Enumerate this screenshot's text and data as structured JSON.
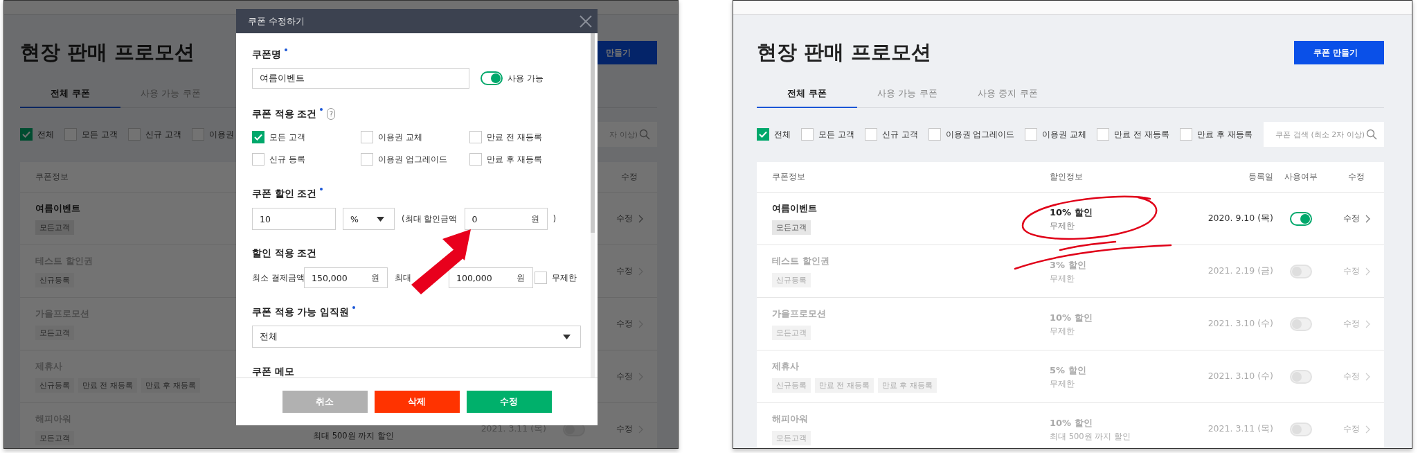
{
  "screenshots": [
    {
      "kind": "dimmed",
      "page": {
        "title": "현장 판매 프로모션",
        "create_button": "만들기",
        "tabs": [
          {
            "label": "전체 쿠폰",
            "selected": true
          },
          {
            "label": "사용 가능 쿠폰",
            "selected": false
          }
        ],
        "filters": [
          {
            "label": "전체",
            "checked": true
          },
          {
            "label": "모든 고객",
            "checked": false
          },
          {
            "label": "신규 고객",
            "checked": false
          },
          {
            "label": "이용권",
            "checked": false
          }
        ],
        "search": {
          "placeholder": "자 이상)"
        },
        "columns": {
          "info": "쿠폰정보",
          "edit": "수정"
        },
        "rows": [
          {
            "name": "여름이벤트",
            "tags": [
              "모든고객"
            ],
            "edit": "수정",
            "disabled": false
          },
          {
            "name": "테스트 할인권",
            "tags": [
              "신규등록"
            ],
            "edit": "수정",
            "disabled": true
          },
          {
            "name": "가을프로모션",
            "tags": [
              "모든고객"
            ],
            "edit": "수정",
            "disabled": true
          },
          {
            "name": "제휴사",
            "tags": [
              "신규등록",
              "만료 전 재등록",
              "만료 후 재등록"
            ],
            "edit": "수정",
            "disabled": true
          },
          {
            "name": "해피아워",
            "tags": [
              "모든고객"
            ],
            "limit": "최대 500원 까지 할인",
            "date": "2021. 3.11 (목)",
            "enabled": false,
            "edit": "수정",
            "disabled": true
          }
        ]
      },
      "dialog": {
        "title": "쿠폰 수정하기",
        "coupon_name": {
          "label": "쿠폰명",
          "required": true,
          "value": "여름이벤트",
          "toggle": {
            "label": "사용 가능",
            "on": true
          }
        },
        "conditions": {
          "label": "쿠폰 적용 조건",
          "required": true,
          "help": "?",
          "options": [
            {
              "label": "모든 고객",
              "checked": true
            },
            {
              "label": "이용권 교체",
              "checked": false
            },
            {
              "label": "만료 전 재등록",
              "checked": false
            },
            {
              "label": "신규 등록",
              "checked": false
            },
            {
              "label": "이용권 업그레이드",
              "checked": false
            },
            {
              "label": "만료 후 재등록",
              "checked": false
            }
          ]
        },
        "discount": {
          "label": "쿠폰 할인 조건",
          "required": true,
          "amount": "10",
          "unit": "%",
          "max_label": "(최대 할인금액",
          "max_value": "0",
          "currency": "원",
          "close_paren": ")"
        },
        "apply": {
          "label": "할인 적용 조건",
          "required": false,
          "min_label": "최소 결제금액",
          "min_value": "150,000",
          "min_currency": "원",
          "max_label": "최대",
          "max_value": "100,000",
          "max_currency": "원",
          "unlimited": {
            "label": "무제한",
            "checked": false
          }
        },
        "staff": {
          "label": "쿠폰 적용 가능 임직원",
          "required": true,
          "value": "전체"
        },
        "memo": {
          "label": "쿠폰 메모"
        },
        "buttons": [
          {
            "label": "취소",
            "kind": "cancel"
          },
          {
            "label": "삭제",
            "kind": "delete"
          },
          {
            "label": "수정",
            "kind": "confirm"
          }
        ]
      }
    },
    {
      "kind": "plain",
      "page": {
        "title": "현장 판매 프로모션",
        "create_button": "쿠폰 만들기",
        "tabs": [
          {
            "label": "전체 쿠폰",
            "selected": true
          },
          {
            "label": "사용 가능 쿠폰",
            "selected": false
          },
          {
            "label": "사용 중지 쿠폰",
            "selected": false
          }
        ],
        "filters": [
          {
            "label": "전체",
            "checked": true
          },
          {
            "label": "모든 고객",
            "checked": false
          },
          {
            "label": "신규 고객",
            "checked": false
          },
          {
            "label": "이용권 업그레이드",
            "checked": false
          },
          {
            "label": "이용권 교체",
            "checked": false
          },
          {
            "label": "만료 전 재등록",
            "checked": false
          },
          {
            "label": "만료 후 재등록",
            "checked": false
          }
        ],
        "search": {
          "placeholder": "쿠폰 검색 (최소 2자 이상)"
        },
        "columns": {
          "info": "쿠폰정보",
          "discount": "할인정보",
          "date": "등록일",
          "usage": "사용여부",
          "edit": "수정"
        },
        "rows": [
          {
            "name": "여름이벤트",
            "tags": [
              "모든고객"
            ],
            "discount": "10% 할인",
            "limit": "무제한",
            "date": "2020. 9.10 (목)",
            "enabled": true,
            "edit": "수정",
            "disabled": false
          },
          {
            "name": "테스트 할인권",
            "tags": [
              "신규등록"
            ],
            "discount": "3% 할인",
            "limit": "무제한",
            "date": "2021. 2.19 (금)",
            "enabled": false,
            "edit": "수정",
            "disabled": true
          },
          {
            "name": "가을프로모션",
            "tags": [
              "모든고객"
            ],
            "discount": "10% 할인",
            "limit": "무제한",
            "date": "2021. 3.10 (수)",
            "enabled": false,
            "edit": "수정",
            "disabled": true
          },
          {
            "name": "제휴사",
            "tags": [
              "신규등록",
              "만료 전 재등록",
              "만료 후 재등록"
            ],
            "discount": "5% 할인",
            "limit": "무제한",
            "date": "2021. 3.10 (수)",
            "enabled": false,
            "edit": "수정",
            "disabled": true
          },
          {
            "name": "해피아워",
            "tags": [
              "모든고객"
            ],
            "discount": "10% 할인",
            "limit": "최대 500원 까지 할인",
            "date": "2021. 3.11 (목)",
            "enabled": false,
            "edit": "수정",
            "disabled": true
          }
        ]
      }
    }
  ]
}
